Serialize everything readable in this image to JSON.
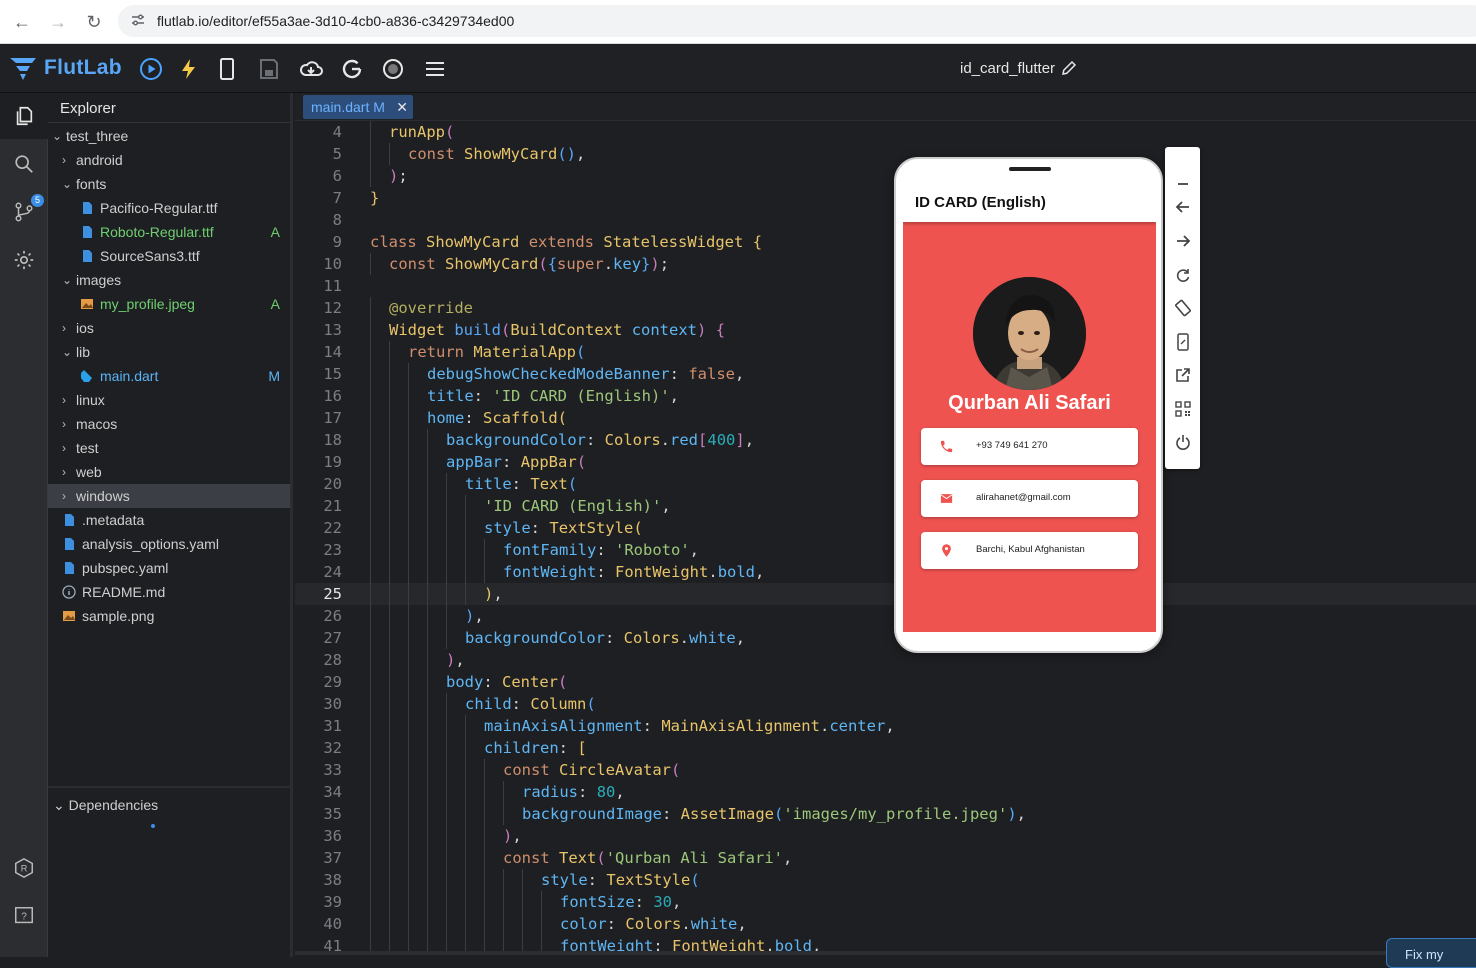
{
  "browser": {
    "url": "flutlab.io/editor/ef55a3ae-3d10-4cb0-a836-c3429734ed00"
  },
  "app": {
    "name": "FlutLab",
    "project_title": "id_card_flutter"
  },
  "activity": {
    "git_badge": "5"
  },
  "explorer": {
    "title": "Explorer",
    "items": [
      {
        "label": "test_three",
        "kind": "folder-open",
        "depth": 0
      },
      {
        "label": "android",
        "kind": "folder",
        "depth": 1
      },
      {
        "label": "fonts",
        "kind": "folder-open",
        "depth": 1
      },
      {
        "label": "Pacifico-Regular.ttf",
        "kind": "file",
        "depth": 2
      },
      {
        "label": "Roboto-Regular.ttf",
        "kind": "file",
        "depth": 2,
        "status": "A"
      },
      {
        "label": "SourceSans3.ttf",
        "kind": "file",
        "depth": 2
      },
      {
        "label": "images",
        "kind": "folder-open",
        "depth": 1
      },
      {
        "label": "my_profile.jpeg",
        "kind": "image",
        "depth": 2,
        "status": "A"
      },
      {
        "label": "ios",
        "kind": "folder",
        "depth": 1
      },
      {
        "label": "lib",
        "kind": "folder-open",
        "depth": 1
      },
      {
        "label": "main.dart",
        "kind": "dart",
        "depth": 2,
        "status": "M"
      },
      {
        "label": "linux",
        "kind": "folder",
        "depth": 1
      },
      {
        "label": "macos",
        "kind": "folder",
        "depth": 1
      },
      {
        "label": "test",
        "kind": "folder",
        "depth": 1
      },
      {
        "label": "web",
        "kind": "folder",
        "depth": 1
      },
      {
        "label": "windows",
        "kind": "folder",
        "depth": 1,
        "selected": true
      },
      {
        "label": ".metadata",
        "kind": "file",
        "depth": 1
      },
      {
        "label": "analysis_options.yaml",
        "kind": "file",
        "depth": 1
      },
      {
        "label": "pubspec.yaml",
        "kind": "file",
        "depth": 1
      },
      {
        "label": "README.md",
        "kind": "info",
        "depth": 1
      },
      {
        "label": "sample.png",
        "kind": "image",
        "depth": 1
      }
    ],
    "dependencies_label": "Dependencies"
  },
  "editor": {
    "tab_label": "main.dart M",
    "current_line": 25,
    "lines": [
      {
        "n": "4",
        "indent": 1,
        "html": "<span class='f'>runApp</span><span class='p'>(</span>"
      },
      {
        "n": "5",
        "indent": 2,
        "html": "<span class='k'>const</span> <span class='f'>ShowMyCard</span><span class='b'>()</span><span class='d'>,</span>"
      },
      {
        "n": "6",
        "indent": 1,
        "html": "<span class='p'>)</span><span class='d'>;</span>"
      },
      {
        "n": "7",
        "indent": 0,
        "html": "<span class='f'>}</span>"
      },
      {
        "n": "8",
        "indent": 0,
        "html": ""
      },
      {
        "n": "9",
        "indent": 0,
        "html": "<span class='k'>class</span> <span class='f'>ShowMyCard</span> <span class='k'>extends</span> <span class='f'>StatelessWidget</span> <span class='f'>{</span>"
      },
      {
        "n": "10",
        "indent": 1,
        "html": "<span class='k'>const</span> <span class='f'>ShowMyCard</span><span class='p'>(</span><span class='b'>{</span><span class='k'>super</span><span class='d'>.</span><span class='n'>key</span><span class='b'>}</span><span class='p'>)</span><span class='d'>;</span>"
      },
      {
        "n": "11",
        "indent": 0,
        "html": ""
      },
      {
        "n": "12",
        "indent": 1,
        "html": "<span class='at'>@override</span>"
      },
      {
        "n": "13",
        "indent": 1,
        "html": "<span class='f'>Widget</span> <span class='b'>build</span><span class='p'>(</span><span class='f'>BuildContext</span> <span class='n'>context</span><span class='p'>)</span> <span class='p'>{</span>"
      },
      {
        "n": "14",
        "indent": 2,
        "html": "<span class='k'>return</span> <span class='f'>MaterialApp</span><span class='b'>(</span>"
      },
      {
        "n": "15",
        "indent": 3,
        "html": "<span class='n'>debugShowCheckedModeBanner</span><span class='d'>:</span> <span class='k'>false</span><span class='d'>,</span>"
      },
      {
        "n": "16",
        "indent": 3,
        "html": "<span class='n'>title</span><span class='d'>:</span> <span class='s'>'ID CARD (English)'</span><span class='d'>,</span>"
      },
      {
        "n": "17",
        "indent": 3,
        "html": "<span class='n'>home</span><span class='d'>:</span> <span class='f'>Scaffold</span><span class='f'>(</span>"
      },
      {
        "n": "18",
        "indent": 4,
        "html": "<span class='n'>backgroundColor</span><span class='d'>:</span> <span class='f'>Colors</span><span class='d'>.</span><span class='n'>red</span><span class='p'>[</span><span class='num'>400</span><span class='p'>]</span><span class='d'>,</span>"
      },
      {
        "n": "19",
        "indent": 4,
        "html": "<span class='n'>appBar</span><span class='d'>:</span> <span class='f'>AppBar</span><span class='p'>(</span>"
      },
      {
        "n": "20",
        "indent": 5,
        "html": "<span class='n'>title</span><span class='d'>:</span> <span class='f'>Text</span><span class='b'>(</span>"
      },
      {
        "n": "21",
        "indent": 6,
        "html": "<span class='s'>'ID CARD (English)'</span><span class='d'>,</span>"
      },
      {
        "n": "22",
        "indent": 6,
        "html": "<span class='n'>style</span><span class='d'>:</span> <span class='f'>TextStyle</span><span class='f'>(</span>"
      },
      {
        "n": "23",
        "indent": 7,
        "html": "<span class='n'>fontFamily</span><span class='d'>:</span> <span class='s'>'Roboto'</span><span class='d'>,</span>"
      },
      {
        "n": "24",
        "indent": 7,
        "html": "<span class='n'>fontWeight</span><span class='d'>:</span> <span class='f'>FontWeight</span><span class='d'>.</span><span class='n'>bold</span><span class='d'>,</span>"
      },
      {
        "n": "25",
        "indent": 6,
        "html": "<span class='f'>)</span><span class='d'>,</span>"
      },
      {
        "n": "26",
        "indent": 5,
        "html": "<span class='b'>)</span><span class='d'>,</span>"
      },
      {
        "n": "27",
        "indent": 5,
        "html": "<span class='n'>backgroundColor</span><span class='d'>:</span> <span class='f'>Colors</span><span class='d'>.</span><span class='n'>white</span><span class='d'>,</span>"
      },
      {
        "n": "28",
        "indent": 4,
        "html": "<span class='p'>)</span><span class='d'>,</span>"
      },
      {
        "n": "29",
        "indent": 4,
        "html": "<span class='n'>body</span><span class='d'>:</span> <span class='f'>Center</span><span class='p'>(</span>"
      },
      {
        "n": "30",
        "indent": 5,
        "html": "<span class='n'>child</span><span class='d'>:</span> <span class='f'>Column</span><span class='b'>(</span>"
      },
      {
        "n": "31",
        "indent": 6,
        "html": "<span class='n'>mainAxisAlignment</span><span class='d'>:</span> <span class='f'>MainAxisAlignment</span><span class='d'>.</span><span class='n'>center</span><span class='d'>,</span>"
      },
      {
        "n": "32",
        "indent": 6,
        "html": "<span class='n'>children</span><span class='d'>:</span> <span class='f'>[</span>"
      },
      {
        "n": "33",
        "indent": 7,
        "html": "<span class='k'>const</span> <span class='f'>CircleAvatar</span><span class='p'>(</span>"
      },
      {
        "n": "34",
        "indent": 8,
        "html": "<span class='n'>radius</span><span class='d'>:</span> <span class='num'>80</span><span class='d'>,</span>"
      },
      {
        "n": "35",
        "indent": 8,
        "html": "<span class='n'>backgroundImage</span><span class='d'>:</span> <span class='f'>AssetImage</span><span class='b'>(</span><span class='s'>'images/my_profile.jpeg'</span><span class='b'>)</span><span class='d'>,</span>"
      },
      {
        "n": "36",
        "indent": 7,
        "html": "<span class='p'>)</span><span class='d'>,</span>"
      },
      {
        "n": "37",
        "indent": 7,
        "html": "<span class='k'>const</span> <span class='f'>Text</span><span class='p'>(</span><span class='s'>'Qurban Ali Safari'</span><span class='d'>,</span>"
      },
      {
        "n": "38",
        "indent": 9,
        "html": "<span class='n'>style</span><span class='d'>:</span> <span class='f'>TextStyle</span><span class='b'>(</span>"
      },
      {
        "n": "39",
        "indent": 10,
        "html": "<span class='n'>fontSize</span><span class='d'>:</span> <span class='num'>30</span><span class='d'>,</span>"
      },
      {
        "n": "40",
        "indent": 10,
        "html": "<span class='n'>color</span><span class='d'>:</span> <span class='f'>Colors</span><span class='d'>.</span><span class='n'>white</span><span class='d'>,</span>"
      },
      {
        "n": "41",
        "indent": 10,
        "html": "<span class='n'>fontWeight</span><span class='d'>:</span> <span class='f'>FontWeight</span><span class='d'>.</span><span class='n'>bold</span><span class='d'>,</span>"
      }
    ]
  },
  "preview": {
    "appbar_title": "ID CARD (English)",
    "name": "Qurban Ali Safari",
    "phone": "+93 749 641 270",
    "email": "alirahanet@gmail.com",
    "address": "Barchi, Kabul Afghanistan",
    "background_color": "#ef5350"
  },
  "tools": [
    "minimize-icon",
    "back-icon",
    "forward-icon",
    "reload-icon",
    "rotate-icon",
    "device-icon",
    "open-external-icon",
    "qr-code-icon",
    "power-icon"
  ],
  "fix_button": {
    "label": "Fix my"
  }
}
